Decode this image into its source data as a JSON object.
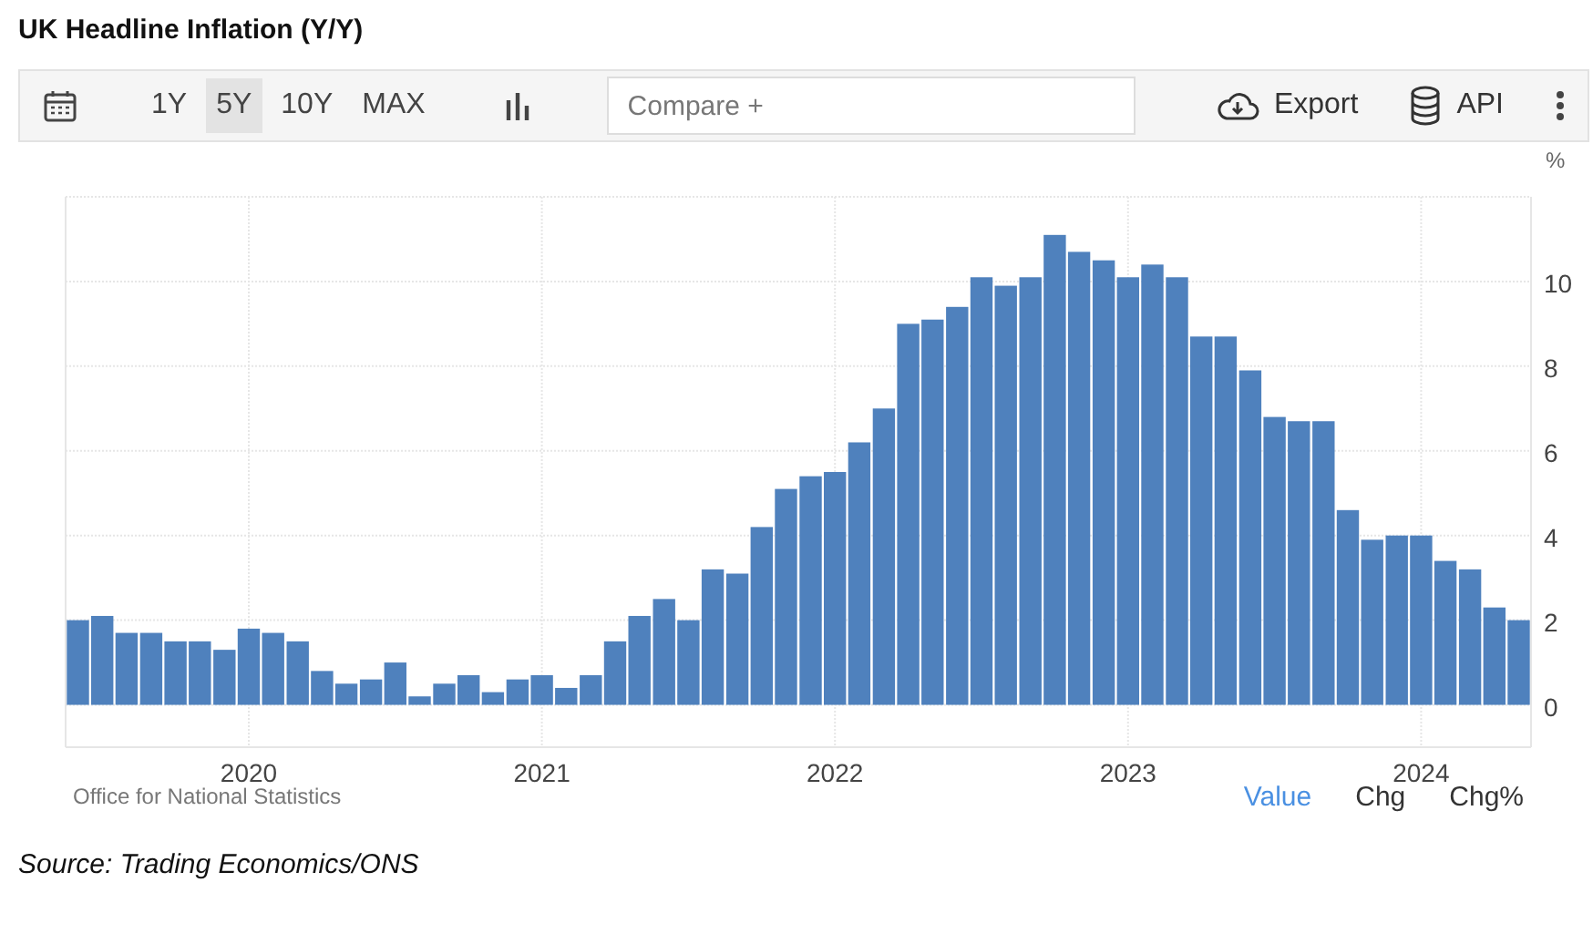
{
  "title": "UK Headline Inflation (Y/Y)",
  "toolbar": {
    "ranges": [
      {
        "label": "1Y",
        "selected": false
      },
      {
        "label": "5Y",
        "selected": true
      },
      {
        "label": "10Y",
        "selected": false
      },
      {
        "label": "MAX",
        "selected": false
      }
    ],
    "compare": {
      "placeholder": "Compare +"
    },
    "actions": [
      {
        "kind": "export",
        "label": "Export"
      },
      {
        "kind": "api",
        "label": "API"
      }
    ]
  },
  "chart": {
    "chart_data": {
      "type": "bar",
      "ylabel": "%",
      "ylim": [
        -1,
        12
      ],
      "yticks": [
        0,
        2,
        4,
        6,
        8,
        10
      ],
      "grid": true,
      "xlim": [
        2019.375,
        2024.375
      ],
      "xticks": [
        2020,
        2021,
        2022,
        2023,
        2024
      ],
      "x": [
        2019.417,
        2019.5,
        2019.583,
        2019.667,
        2019.75,
        2019.833,
        2019.917,
        2020,
        2020.083,
        2020.167,
        2020.25,
        2020.333,
        2020.417,
        2020.5,
        2020.583,
        2020.667,
        2020.75,
        2020.833,
        2020.917,
        2021,
        2021.083,
        2021.167,
        2021.25,
        2021.333,
        2021.417,
        2021.5,
        2021.583,
        2021.667,
        2021.75,
        2021.833,
        2021.917,
        2022,
        2022.083,
        2022.167,
        2022.25,
        2022.333,
        2022.417,
        2022.5,
        2022.583,
        2022.667,
        2022.75,
        2022.833,
        2022.917,
        2023,
        2023.083,
        2023.167,
        2023.25,
        2023.333,
        2023.417,
        2023.5,
        2023.583,
        2023.667,
        2023.75,
        2023.833,
        2023.917,
        2024,
        2024.083,
        2024.167,
        2024.25,
        2024.333
      ],
      "series": [
        {
          "color": "#4f81bd",
          "values": [
            2.0,
            2.1,
            1.7,
            1.7,
            1.5,
            1.5,
            1.3,
            1.8,
            1.7,
            1.5,
            0.8,
            0.5,
            0.6,
            1.0,
            0.2,
            0.5,
            0.7,
            0.3,
            0.6,
            0.7,
            0.4,
            0.7,
            1.5,
            2.1,
            2.5,
            2.0,
            3.2,
            3.1,
            4.2,
            5.1,
            5.4,
            5.5,
            6.2,
            7.0,
            9.0,
            9.1,
            9.4,
            10.1,
            9.9,
            10.1,
            11.1,
            10.7,
            10.5,
            10.1,
            10.4,
            10.1,
            8.7,
            8.7,
            7.9,
            6.8,
            6.7,
            6.7,
            4.6,
            3.9,
            4.0,
            4.0,
            3.4,
            3.2,
            2.3,
            2.0
          ]
        }
      ]
    }
  },
  "footer": {
    "source_label": "Office for National Statistics",
    "views": [
      {
        "label": "Value",
        "selected": true
      },
      {
        "label": "Chg",
        "selected": false
      },
      {
        "label": "Chg%",
        "selected": false
      }
    ]
  },
  "source": "Source: Trading Economics/ONS"
}
